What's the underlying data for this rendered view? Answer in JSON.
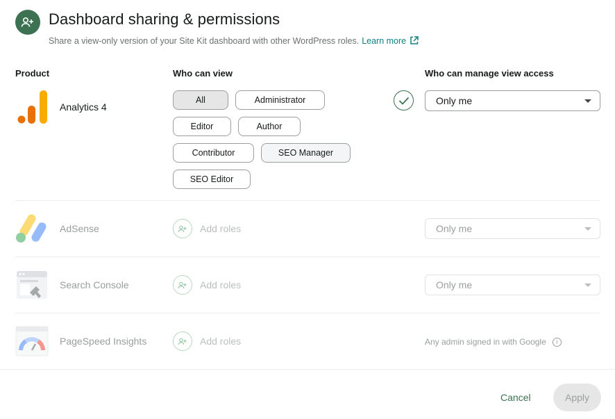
{
  "dialog": {
    "title": "Dashboard sharing & permissions",
    "subtitle": "Share a view-only version of your Site Kit dashboard with other WordPress roles.",
    "learn_more": "Learn more"
  },
  "columns": {
    "product": "Product",
    "who_can_view": "Who can view",
    "who_can_manage": "Who can manage view access"
  },
  "products": [
    {
      "name": "Analytics 4",
      "icon": "analytics-icon",
      "roles": [
        "All",
        "Administrator",
        "Editor",
        "Author",
        "Contributor",
        "SEO Manager",
        "SEO Editor"
      ],
      "selected_role": "All",
      "manage_access": "Only me",
      "enabled": true
    },
    {
      "name": "AdSense",
      "icon": "adsense-icon",
      "add_roles": "Add roles",
      "manage_access": "Only me",
      "enabled": false
    },
    {
      "name": "Search Console",
      "icon": "search-console-icon",
      "add_roles": "Add roles",
      "manage_access": "Only me",
      "enabled": false
    },
    {
      "name": "PageSpeed Insights",
      "icon": "pagespeed-icon",
      "add_roles": "Add roles",
      "manage_access": "Any admin signed in with Google",
      "enabled": false
    }
  ],
  "footer": {
    "cancel": "Cancel",
    "apply": "Apply"
  },
  "colors": {
    "accent": "#3c7251",
    "link": "#108080",
    "muted": "#999f9b"
  }
}
